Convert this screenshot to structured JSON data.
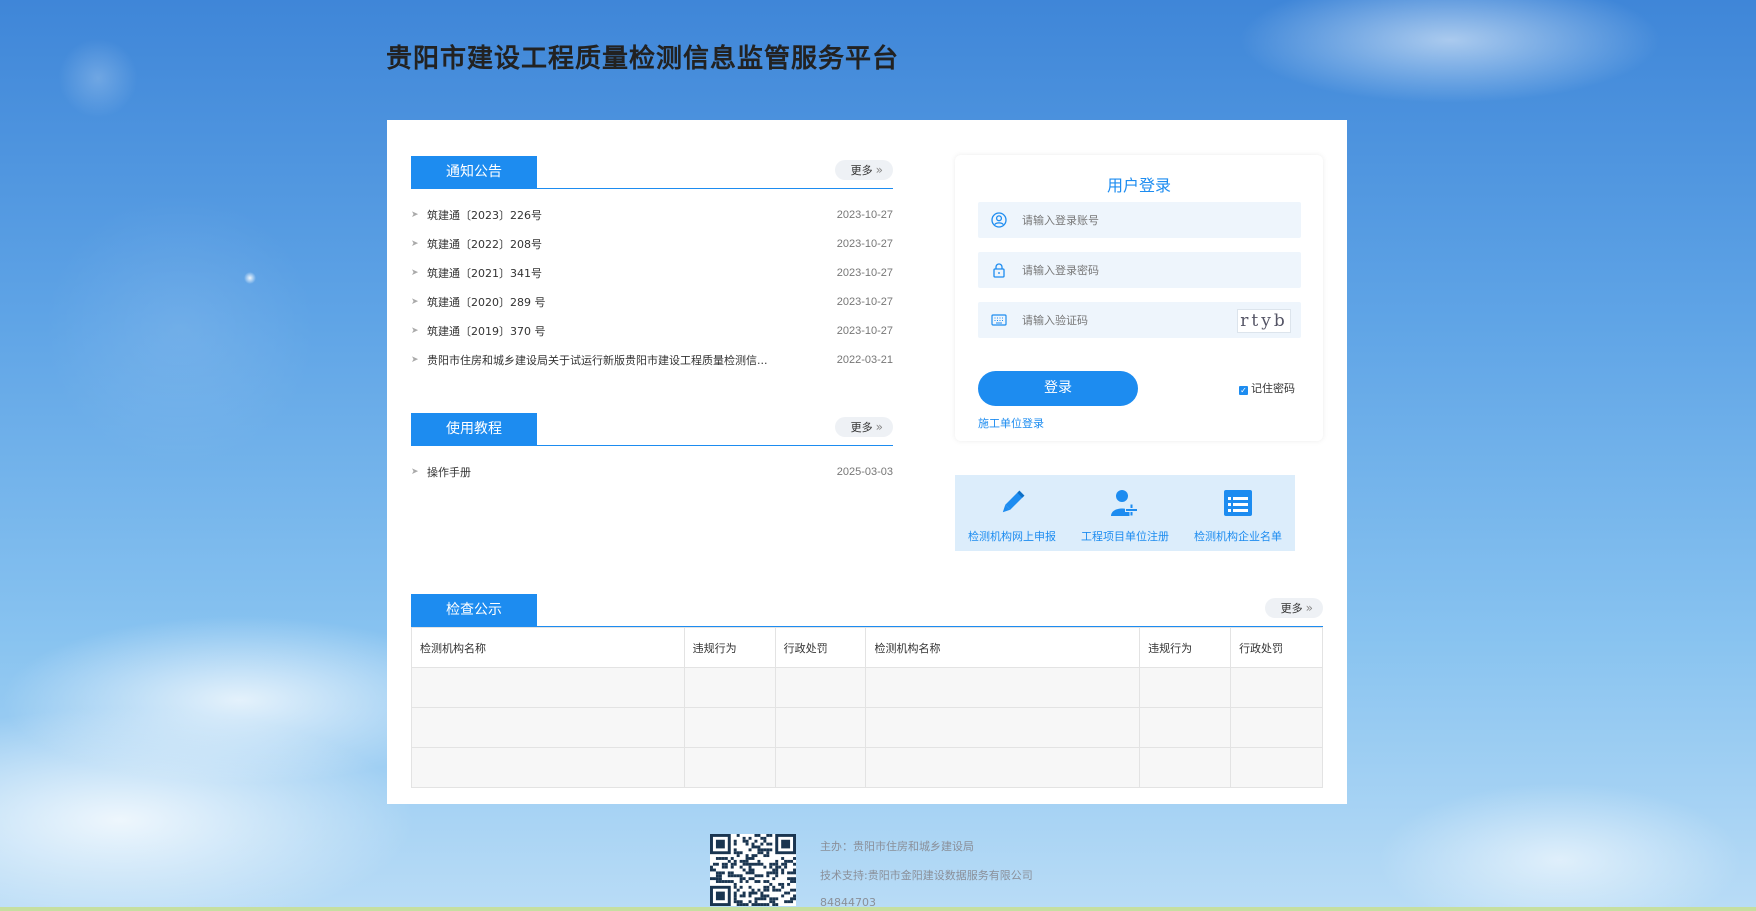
{
  "header": {
    "title": "贵阳市建设工程质量检测信息监管服务平台"
  },
  "notices": {
    "tab": "通知公告",
    "more": "更多",
    "items": [
      {
        "title": "筑建通〔2023〕226号",
        "date": "2023-10-27"
      },
      {
        "title": "筑建通〔2022〕208号",
        "date": "2023-10-27"
      },
      {
        "title": "筑建通〔2021〕341号",
        "date": "2023-10-27"
      },
      {
        "title": "筑建通〔2020〕289 号",
        "date": "2023-10-27"
      },
      {
        "title": "筑建通〔2019〕370 号",
        "date": "2023-10-27"
      },
      {
        "title": "贵阳市住房和城乡建设局关于试运行新版贵阳市建设工程质量检测信...",
        "date": "2022-03-21"
      }
    ]
  },
  "tutorials": {
    "tab": "使用教程",
    "more": "更多",
    "items": [
      {
        "title": "操作手册",
        "date": "2025-03-03"
      }
    ]
  },
  "login": {
    "title": "用户登录",
    "account_placeholder": "请输入登录账号",
    "password_placeholder": "请输入登录密码",
    "captcha_placeholder": "请输入验证码",
    "captcha_text": "rtyb",
    "submit": "登录",
    "remember": "记住密码",
    "unit_login": "施工单位登录"
  },
  "quick_links": [
    {
      "label": "检测机构网上申报",
      "icon": "pencil-icon"
    },
    {
      "label": "工程项目单位注册",
      "icon": "user-add-icon"
    },
    {
      "label": "检测机构企业名单",
      "icon": "list-icon"
    }
  ],
  "inspection": {
    "tab": "检查公示",
    "more": "更多",
    "columns": [
      "检测机构名称",
      "违规行为",
      "行政处罚",
      "检测机构名称",
      "违规行为",
      "行政处罚"
    ],
    "rows": [
      [
        "",
        "",
        "",
        "",
        "",
        ""
      ],
      [
        "",
        "",
        "",
        "",
        "",
        ""
      ],
      [
        "",
        "",
        "",
        "",
        "",
        ""
      ]
    ]
  },
  "footer": {
    "sponsor": "主办：贵阳市住房和城乡建设局",
    "support": "技术支持:贵阳市金阳建设数据服务有限公司",
    "phone": "84844703"
  },
  "colors": {
    "accent": "#1d8cf0",
    "quick_bg": "#dcedfb"
  }
}
